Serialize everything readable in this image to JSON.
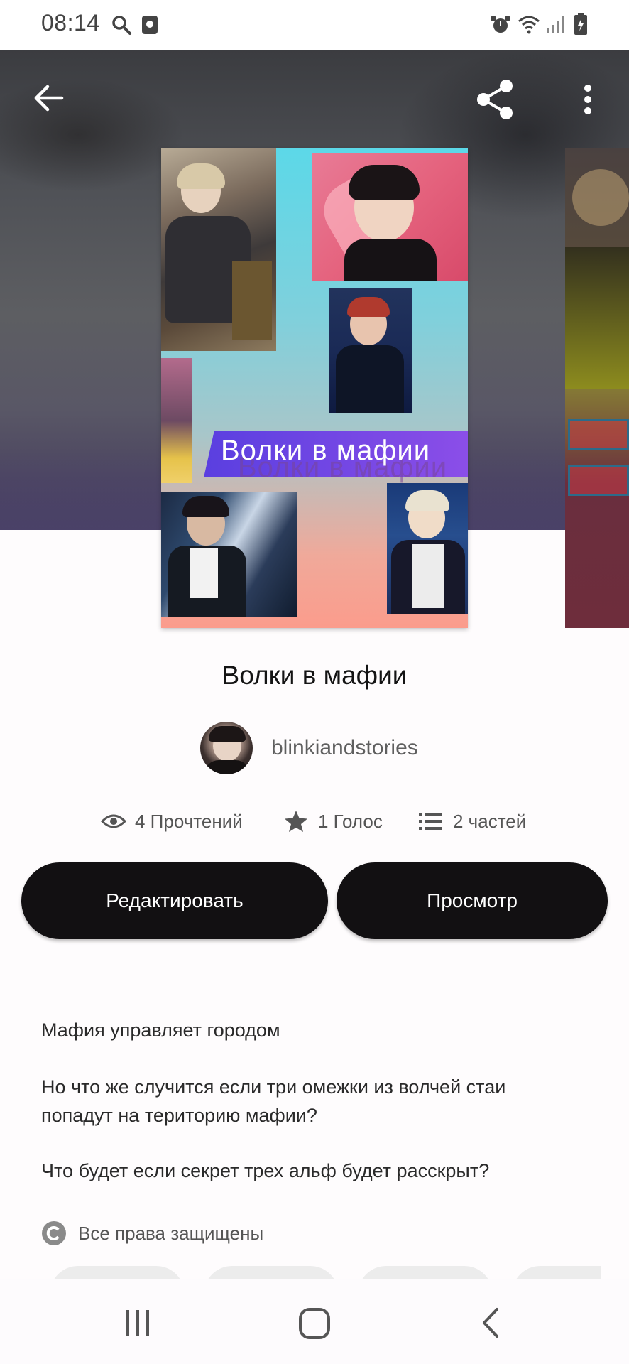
{
  "status_bar": {
    "time": "08:14"
  },
  "header": {
    "back_icon": "arrow-left-icon",
    "share_icon": "share-icon",
    "menu_icon": "more-vertical-icon"
  },
  "cover": {
    "title_text": "Волки в мафии"
  },
  "story": {
    "title": "Волки в мафии",
    "author": "blinkiandstories",
    "stats": {
      "reads": "4 Прочтений",
      "votes": "1 Голос",
      "parts": "2 частей"
    }
  },
  "actions": {
    "edit_label": "Редактировать",
    "view_label": "Просмотр"
  },
  "description": {
    "line1": "Мафия управляет городом",
    "line2": "Но что же случится если три омежки из волчей стаи попадут на територию мафии?",
    "line3": "Что будет если секрет трех альф будет расскрыт?"
  },
  "rights": {
    "label": "Все права защищены"
  },
  "nav_bar": {
    "recents_icon": "recent-apps-icon",
    "home_icon": "home-icon",
    "back_icon": "back-chevron-icon"
  }
}
